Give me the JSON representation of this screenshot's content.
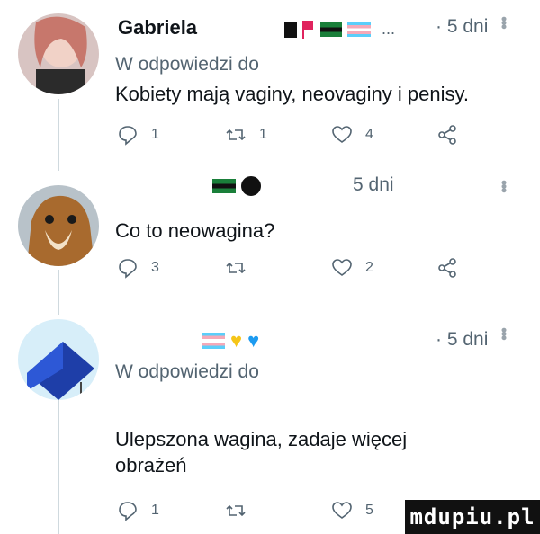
{
  "tweets": [
    {
      "author": "Gabriela",
      "flags_suffix": "...",
      "time": "· 5 dni",
      "reply_to": "W odpowiedzi do",
      "text": "Kobiety mają vaginy, neovaginy i penisy.",
      "replies": "1",
      "retweets": "1",
      "likes": "4"
    },
    {
      "author": "",
      "time": "5 dni",
      "text": "Co to neowagina?",
      "replies": "3",
      "retweets": "",
      "likes": "2"
    },
    {
      "author": "",
      "time": "· 5 dni",
      "reply_to": "W odpowiedzi do",
      "text": "Ulepszona wagina, zadaje więcej obrażeń",
      "replies": "1",
      "retweets": "",
      "likes": "5"
    }
  ],
  "watermark": "mdupiu.pl",
  "colors": {
    "text": "#0f1419",
    "muted": "#536471",
    "thread": "#cfd9de",
    "pride_yellow": "#f5c518",
    "pride_blue": "#1d9bf0"
  },
  "icons": [
    "reply-icon",
    "retweet-icon",
    "like-icon",
    "share-icon",
    "more-icon"
  ]
}
